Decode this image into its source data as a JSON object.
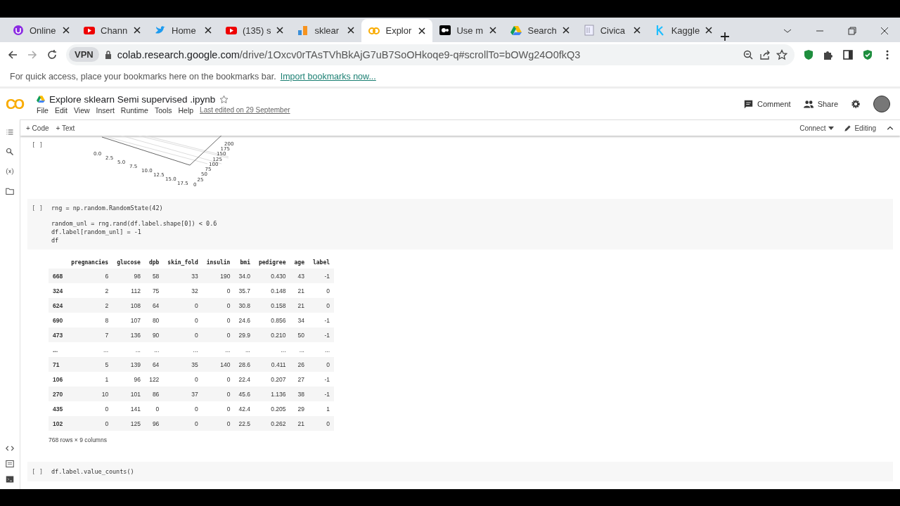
{
  "browser": {
    "tabs": [
      {
        "title": "Online",
        "kind": "u-circle",
        "selected": false
      },
      {
        "title": "Chann",
        "kind": "play",
        "selected": false
      },
      {
        "title": "Home",
        "kind": "bird",
        "selected": false
      },
      {
        "title": "(135) s",
        "kind": "play",
        "selected": false
      },
      {
        "title": "sklear",
        "kind": "bars",
        "selected": false
      },
      {
        "title": "Explor",
        "kind": "co",
        "selected": true
      },
      {
        "title": "Use m",
        "kind": "dots",
        "selected": false
      },
      {
        "title": "Search",
        "kind": "triangle",
        "selected": false
      },
      {
        "title": "Civica",
        "kind": "doc",
        "selected": false
      },
      {
        "title": "Kaggle",
        "kind": "k",
        "selected": false
      }
    ],
    "badge": "VPN",
    "url_host": "colab.research.google.com",
    "url_path": "/drive/1Oxcv0rTAsTVhBkAjG7uB7SoOHkoqe9-q#scrollTo=bOWg24O0fkQ3",
    "bookmarks_hint": "For quick access, place your bookmarks here on the bookmarks bar.",
    "bookmarks_link": "Import bookmarks now..."
  },
  "notebook": {
    "logo": "CO",
    "title": "Explore sklearn Semi supervised .ipynb",
    "menu": [
      "File",
      "Edit",
      "View",
      "Insert",
      "Runtime",
      "Tools",
      "Help"
    ],
    "last_edited": "Last edited on 29 September",
    "comment": "Comment",
    "share": "Share",
    "add_code": "+ Code",
    "add_text": "+ Text",
    "connect": "Connect",
    "editing": "Editing"
  },
  "plot": {
    "x_ticks": [
      "0.0",
      "2.5",
      "5.0",
      "7.5",
      "10.0",
      "12.5",
      "15.0",
      "17.5"
    ],
    "y_ticks": [
      "0",
      "25",
      "50",
      "75",
      "100",
      "125",
      "150",
      "175",
      "200"
    ]
  },
  "cells": [
    {
      "prompt": "[ ]",
      "groups": [
        [
          "rng = np.random.RandomState(42)"
        ],
        [
          "random_unl = rng.rand(df.label.shape[0]) < 0.6",
          "df.label[random_unl] = -1",
          "df"
        ]
      ]
    }
  ],
  "table": {
    "columns": [
      "",
      "pregnancies",
      "glucose",
      "dpb",
      "skin_fold",
      "insulin",
      "bmi",
      "pedigree",
      "age",
      "label"
    ],
    "rows": [
      [
        "668",
        "6",
        "98",
        "58",
        "33",
        "190",
        "34.0",
        "0.430",
        "43",
        "-1"
      ],
      [
        "324",
        "2",
        "112",
        "75",
        "32",
        "0",
        "35.7",
        "0.148",
        "21",
        "0"
      ],
      [
        "624",
        "2",
        "108",
        "64",
        "0",
        "0",
        "30.8",
        "0.158",
        "21",
        "0"
      ],
      [
        "690",
        "8",
        "107",
        "80",
        "0",
        "0",
        "24.6",
        "0.856",
        "34",
        "-1"
      ],
      [
        "473",
        "7",
        "136",
        "90",
        "0",
        "0",
        "29.9",
        "0.210",
        "50",
        "-1"
      ],
      [
        "...",
        "...",
        "...",
        "...",
        "...",
        "...",
        "...",
        "...",
        "...",
        "..."
      ],
      [
        "71",
        "5",
        "139",
        "64",
        "35",
        "140",
        "28.6",
        "0.411",
        "26",
        "0"
      ],
      [
        "106",
        "1",
        "96",
        "122",
        "0",
        "0",
        "22.4",
        "0.207",
        "27",
        "-1"
      ],
      [
        "270",
        "10",
        "101",
        "86",
        "37",
        "0",
        "45.6",
        "1.136",
        "38",
        "-1"
      ],
      [
        "435",
        "0",
        "141",
        "0",
        "0",
        "0",
        "42.4",
        "0.205",
        "29",
        "1"
      ],
      [
        "102",
        "0",
        "125",
        "96",
        "0",
        "0",
        "22.5",
        "0.262",
        "21",
        "0"
      ]
    ],
    "footer": "768 rows × 9 columns"
  },
  "next_cell": {
    "prompt": "[ ]",
    "code": "df.label.value_counts()"
  }
}
